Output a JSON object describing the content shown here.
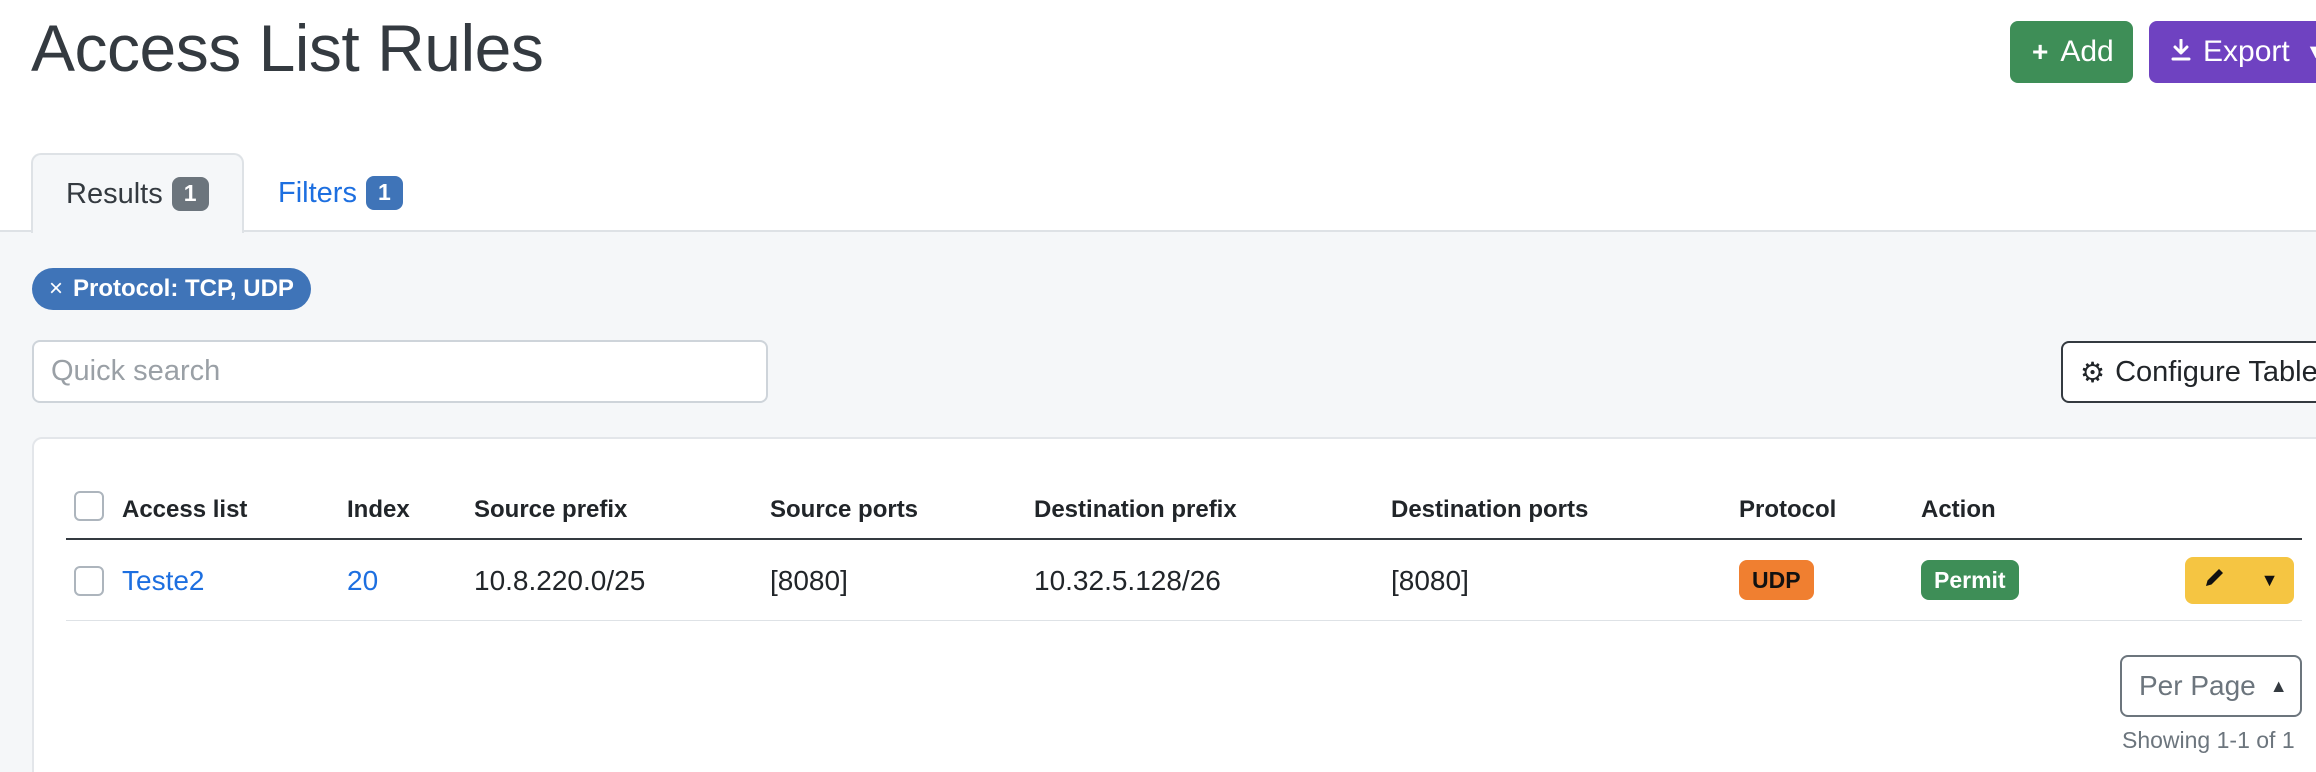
{
  "page": {
    "title": "Access List Rules"
  },
  "header_actions": {
    "add_label": "Add",
    "export_label": "Export"
  },
  "tabs": [
    {
      "label": "Results",
      "count": "1",
      "active": true
    },
    {
      "label": "Filters",
      "count": "1",
      "active": false
    }
  ],
  "active_filter": {
    "remove_symbol": "×",
    "label": "Protocol: TCP, UDP"
  },
  "search": {
    "placeholder": "Quick search",
    "value": ""
  },
  "configure_table_label": "Configure Table",
  "table": {
    "columns": [
      "Access list",
      "Index",
      "Source prefix",
      "Source ports",
      "Destination prefix",
      "Destination ports",
      "Protocol",
      "Action"
    ],
    "rows": [
      {
        "access_list": "Teste2",
        "index": "20",
        "source_prefix": "10.8.220.0/25",
        "source_ports": "[8080]",
        "destination_prefix": "10.32.5.128/26",
        "destination_ports": "[8080]",
        "protocol": "UDP",
        "action": "Permit"
      }
    ]
  },
  "pagination": {
    "per_page_label": "Per Page",
    "showing": "Showing 1-1 of 1"
  },
  "colors": {
    "add": "#3e8e57",
    "export": "#6f42c1",
    "link": "#1d6fe0",
    "filter_pill": "#3f74b8",
    "protocol_udp": "#f07f30",
    "action_permit": "#3e8e57",
    "row_actions": "#f5c542"
  },
  "icons": {
    "add": "plus-icon",
    "export": "download-icon",
    "configure": "gear-icon",
    "edit": "pencil-icon"
  }
}
